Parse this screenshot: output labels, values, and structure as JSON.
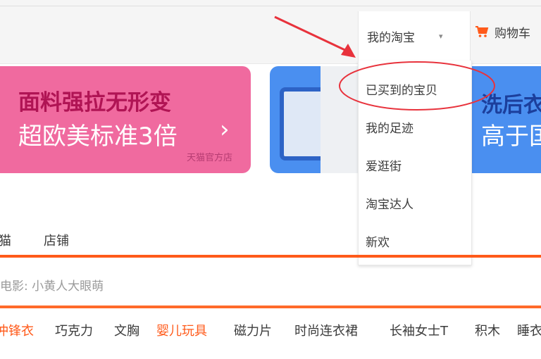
{
  "topbar": {
    "my_taobao_label": "我的淘宝",
    "cart_label": "购物车"
  },
  "dropdown": {
    "items": [
      "已买到的宝贝",
      "我的足迹",
      "爱逛街",
      "淘宝达人",
      "新欢"
    ]
  },
  "banners": {
    "left": {
      "line1": "面料强拉无形变",
      "line2": "超欧美标准3倍",
      "arrow": "›",
      "brand": "天猫官方店"
    },
    "right": {
      "line1": "洗后衣",
      "line2": "高于国"
    }
  },
  "search_tabs": {
    "items": [
      "猫",
      "店铺"
    ]
  },
  "search": {
    "hint": "电影: 小黄人大眼萌"
  },
  "hot_keywords": [
    {
      "text": "冲锋衣",
      "hot": true
    },
    {
      "text": "巧克力",
      "hot": false
    },
    {
      "text": "文胸",
      "hot": false
    },
    {
      "text": "婴儿玩具",
      "hot": true
    },
    {
      "text": "磁力片",
      "hot": false
    },
    {
      "text": "时尚连衣裙",
      "hot": false
    },
    {
      "text": "长袖女士T",
      "hot": false
    },
    {
      "text": "积木",
      "hot": false
    },
    {
      "text": "睡衣",
      "hot": false
    }
  ],
  "colors": {
    "accent_orange": "#ff5a1a",
    "annotation_red": "#e8323c",
    "banner_pink": "#f06a9f",
    "banner_blue": "#4a8ff0"
  },
  "icons": {
    "cart": "cart-icon",
    "caret": "chevron-down-icon"
  }
}
